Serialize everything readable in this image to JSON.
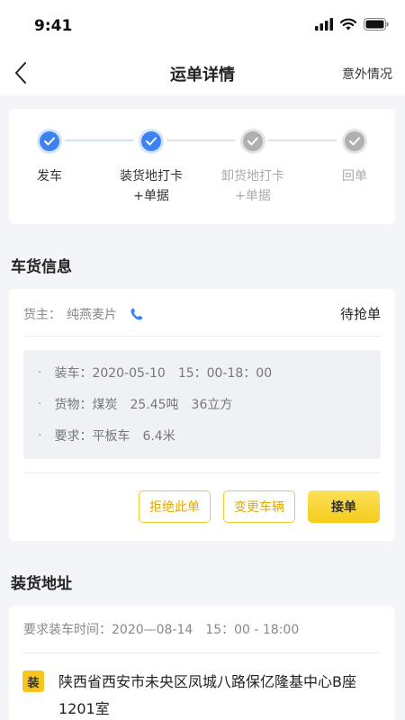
{
  "status_bar": {
    "time": "9:41"
  },
  "nav": {
    "title": "运单详情",
    "action": "意外情况"
  },
  "progress": {
    "steps": [
      {
        "label": "发车",
        "done": true
      },
      {
        "label": "装货地打卡\n+单据",
        "done": true
      },
      {
        "label": "卸货地打卡\n+单据",
        "done": false
      },
      {
        "label": "回单",
        "done": false
      }
    ]
  },
  "cargo_section": {
    "title": "车货信息",
    "owner_label": "货主：",
    "owner_name": "纯燕麦片",
    "status": "待抢单",
    "items": [
      "装车：2020-05-10　15：00-18：00",
      "货物：煤炭　25.45吨　36立方",
      "要求：平板车　6.4米"
    ],
    "bullet": "·",
    "buttons": {
      "reject": "拒绝此单",
      "change_vehicle": "变更车辆",
      "accept": "接单"
    }
  },
  "loading_section": {
    "title": "装货地址",
    "time": "要求装车时间：2020—08-14　15：00 - 18:00",
    "tag": "装",
    "address": "陕西省西安市未央区凤城八路保亿隆基中心B座1201室"
  },
  "colors": {
    "accent_blue": "#3c82f0",
    "accent_yellow": "#f5cc1c",
    "inactive_gray": "#b0b0b0"
  }
}
